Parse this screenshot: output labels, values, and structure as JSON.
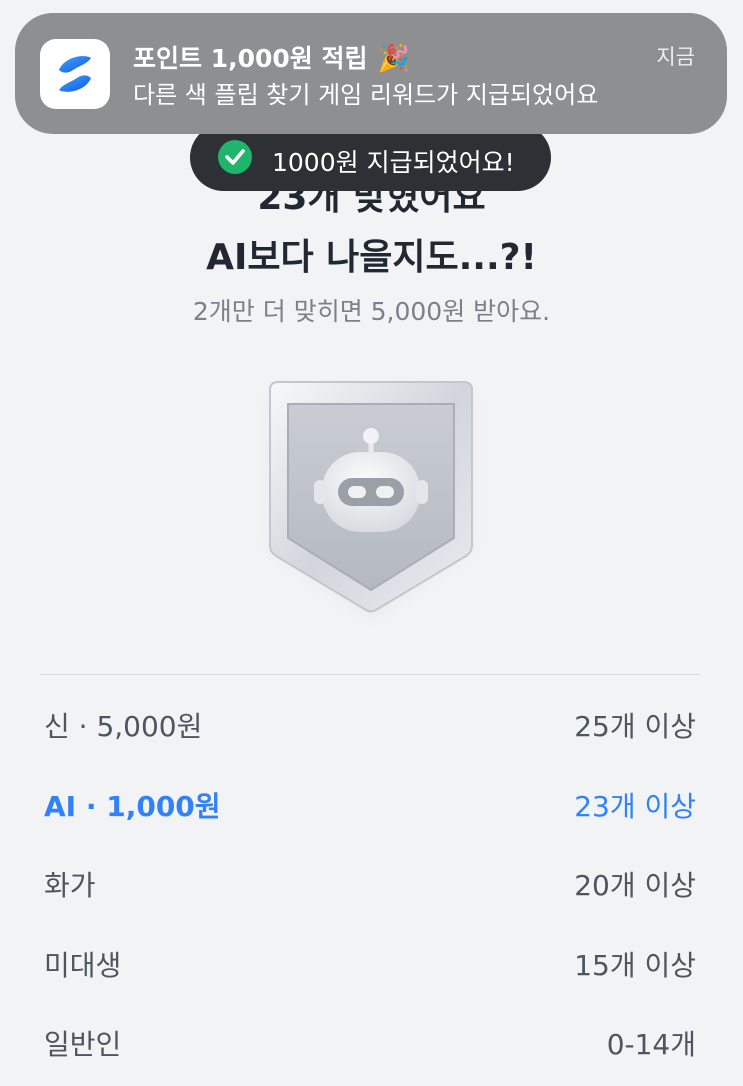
{
  "notification": {
    "title": "포인트 1,000원 적립",
    "emoji": "🎉",
    "body": "다른 색 플립 찾기 게임 리워드가 지급되었어요",
    "time": "지금"
  },
  "toast": {
    "message": "1000원 지급되었어요!"
  },
  "result": {
    "headline_partial": "23개 맞혔어요",
    "headline": "AI보다 나을지도...?!",
    "subtitle": "2개만 더 맞히면 5,000원 받아요."
  },
  "colors": {
    "accent": "#3182f6",
    "toast_bg": "#2d3035",
    "check_green": "#1fb56b",
    "notification_bg": "#8e8f90"
  },
  "tiers": [
    {
      "name": "신 · 5,000원",
      "requirement": "25개 이상",
      "active": false
    },
    {
      "name": "AI · 1,000원",
      "requirement": "23개 이상",
      "active": true
    },
    {
      "name": "화가",
      "requirement": "20개 이상",
      "active": false
    },
    {
      "name": "미대생",
      "requirement": "15개 이상",
      "active": false
    },
    {
      "name": "일반인",
      "requirement": "0-14개",
      "active": false
    }
  ]
}
